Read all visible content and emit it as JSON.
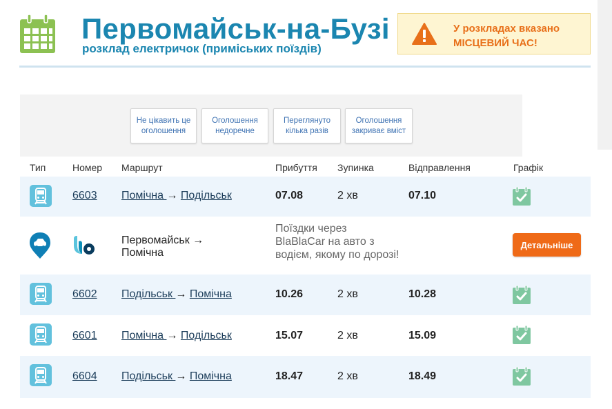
{
  "header": {
    "title": "Первомайськ-на-Бузі",
    "subtitle": "розклад електричок (приміських поїздів)"
  },
  "notice": {
    "line1": "У розкладах вказано",
    "line2": "МІСЦЕВИЙ ЧАС!"
  },
  "ad_feedback": {
    "buttons": [
      "Не цікавить це оголошення",
      "Оголошення недоречне",
      "Переглянуто кілька разів",
      "Оголошення закриває вміст"
    ]
  },
  "table": {
    "columns": [
      "Тип",
      "Номер",
      "Маршрут",
      "Прибуття",
      "Зупинка",
      "Відправлення",
      "Графік"
    ],
    "rows": [
      {
        "number": "6603",
        "from": "Помічна ",
        "arrow": "→ ",
        "to": "Подільськ",
        "arrival": "07.08",
        "stop": "2 хв",
        "departure": "07.10"
      },
      {
        "number": "6602",
        "from": "Подільськ ",
        "arrow": "→ ",
        "to": "Помічна",
        "arrival": "10.26",
        "stop": "2 хв",
        "departure": "10.28"
      },
      {
        "number": "6601",
        "from": "Помічна ",
        "arrow": "→ ",
        "to": "Подільськ",
        "arrival": "15.07",
        "stop": "2 хв",
        "departure": "15.09"
      },
      {
        "number": "6604",
        "from": "Подільськ ",
        "arrow": "→ ",
        "to": "Помічна",
        "arrival": "18.47",
        "stop": "2 хв",
        "departure": "18.49"
      }
    ]
  },
  "blablacar": {
    "route": "Первомайськ → Помічна",
    "description": "Поїздки через BlaBlaCar на авто з водієм, якому по дорозі!",
    "button_label": "Детальніше"
  },
  "colors": {
    "brand": "#1b86b0",
    "accent_orange": "#ef6a17",
    "train_icon": "#62c1dd",
    "schedule_icon": "#7fc7a0",
    "calendar_icon": "#8cc152"
  }
}
